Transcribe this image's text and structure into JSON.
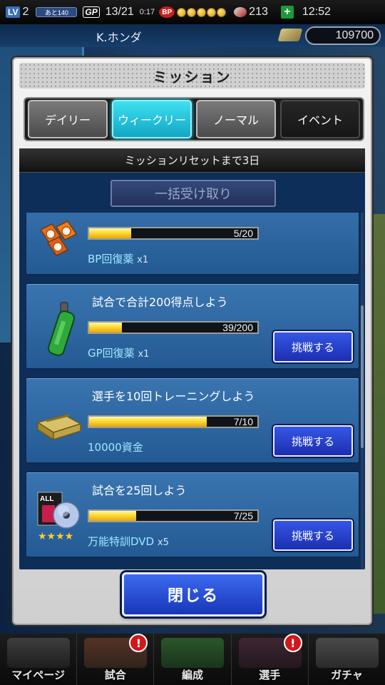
{
  "status_bar": {
    "level_label": "LV",
    "level_value": "2",
    "exp_label": "あと140",
    "gp_label": "GP",
    "gp_value": "13/21",
    "gp_timer": "0:17",
    "bp_label": "BP",
    "bp_coins": 5,
    "tickets": "213",
    "plus_label": "+",
    "clock": "12:52"
  },
  "header": {
    "player_name": "K.ホンダ",
    "money": "109700"
  },
  "modal": {
    "title": "ミッション",
    "tabs": [
      {
        "label": "デイリー",
        "state": "normal"
      },
      {
        "label": "ウィークリー",
        "state": "active"
      },
      {
        "label": "ノーマル",
        "state": "normal"
      },
      {
        "label": "イベント",
        "state": "dark"
      }
    ],
    "reset_text": "ミッションリセットまで3日",
    "bulk_receive_label": "一括受け取り",
    "missions": [
      {
        "title": "",
        "progress_text": "5/20",
        "progress": 0.25,
        "reward": "BP回復薬",
        "reward_qty": "x1",
        "button": "",
        "icon": "bp-potion-icon"
      },
      {
        "title": "試合で合計200得点しよう",
        "progress_text": "39/200",
        "progress": 0.195,
        "reward": "GP回復薬",
        "reward_qty": "x1",
        "button": "挑戦する",
        "icon": "green-bottle-icon"
      },
      {
        "title": "選手を10回トレーニングしよう",
        "progress_text": "7/10",
        "progress": 0.7,
        "reward": "10000資金",
        "reward_qty": "",
        "button": "挑戦する",
        "icon": "money-bundle-icon"
      },
      {
        "title": "試合を25回しよう",
        "progress_text": "7/25",
        "progress": 0.28,
        "reward": "万能特訓DVD",
        "reward_qty": "x5",
        "button": "挑戦する",
        "icon": "dvd-icon"
      }
    ],
    "close_label": "閉じる"
  },
  "bottom_nav": [
    {
      "label": "マイページ",
      "alert": false
    },
    {
      "label": "試合",
      "alert": true
    },
    {
      "label": "編成",
      "alert": false
    },
    {
      "label": "選手",
      "alert": true
    },
    {
      "label": "ガチャ",
      "alert": false
    }
  ],
  "colors": {
    "accent_tab": "#12a6c4",
    "challenge_button": "#1b2fb0",
    "progress_fill": "#ffdf38",
    "panel_bg": "#0e2e5a",
    "card_bg": "#245a94",
    "reward_text": "#9ee8ff"
  }
}
